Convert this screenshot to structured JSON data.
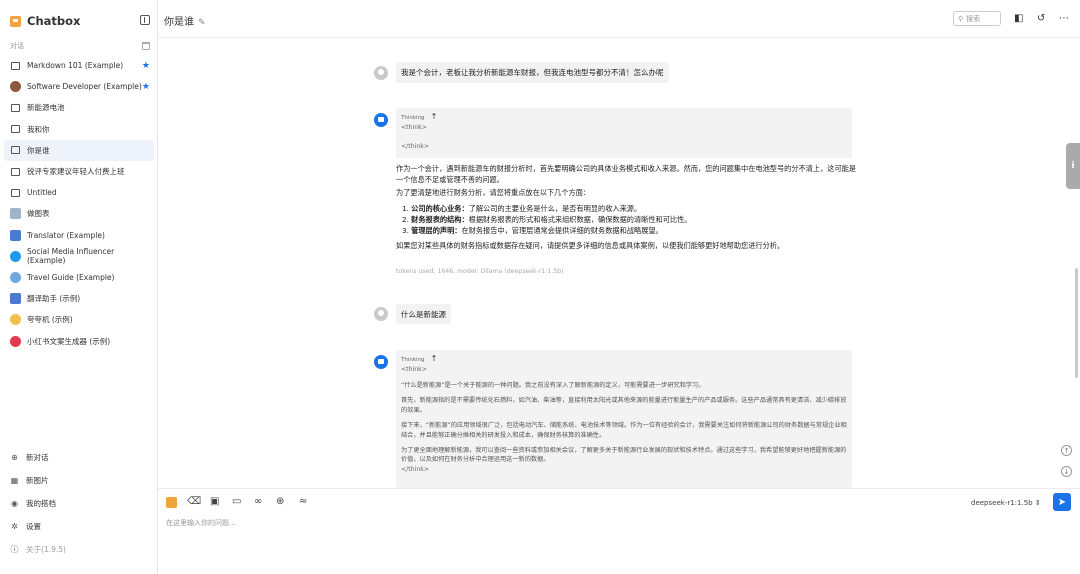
{
  "app": {
    "title": "Chatbox"
  },
  "sidebar": {
    "section_label": "对话",
    "conversations": [
      {
        "label": "Markdown 101 (Example)",
        "starred": true
      },
      {
        "label": "Software Developer (Example)",
        "starred": true
      },
      {
        "label": "新能源电池"
      },
      {
        "label": "我和你"
      },
      {
        "label": "你是谁",
        "active": true
      },
      {
        "label": "锐评专家建议年轻人付费上班"
      },
      {
        "label": "Untitled"
      },
      {
        "label": "做图表"
      },
      {
        "label": "Translator (Example)"
      },
      {
        "label": "Social Media Influencer (Example)"
      },
      {
        "label": "Travel Guide (Example)"
      },
      {
        "label": "翻译助手 (示例)"
      },
      {
        "label": "夸夸机 (示例)"
      },
      {
        "label": "小红书文案生成器 (示例)"
      }
    ],
    "bottom": {
      "new_chat": "新对话",
      "new_image": "新图片",
      "my_partners": "我的搭档",
      "settings": "设置",
      "about": "关于(1.9.5)"
    }
  },
  "header": {
    "title": "你是谁",
    "search_placeholder": "搜索"
  },
  "messages": {
    "q1": "我是个会计，老板让我分析新能源车财报，但我连电池型号都分不清！怎么办呢",
    "a1": {
      "thinking_label": "Thinking",
      "think_open": "<think>",
      "think_close": "</think>",
      "intro": "作为一个会计，遇到新能源车的财报分析时，首先要明确公司的具体业务模式和收入来源。然而，您的问题集中在电池型号的分不清上，这可能是一个信息不足或管理不善的问题。",
      "lead": "为了更清楚地进行财务分析，请您将重点放在以下几个方面：",
      "items": [
        {
          "num": "1.",
          "bold": "公司的核心业务：",
          "text": "了解公司的主要业务是什么，是否有明显的收入来源。"
        },
        {
          "num": "2.",
          "bold": "财务报表的结构：",
          "text": "根据财务报表的形式和格式来组织数据，确保数据的清晰性和可比性。"
        },
        {
          "num": "3.",
          "bold": "管理层的声明：",
          "text": "在财务报告中，管理层通常会提供详细的财务数据和战略展望。"
        }
      ],
      "outro": "如果您对某些具体的财务指标或数据存在疑问，请提供更多详细的信息或具体案例，以便我们能够更好地帮助您进行分析。",
      "meta": "tokens used: 1646, model: Ollama (deepseek-r1:1.5b)"
    },
    "q2": "什么是新能源",
    "a2": {
      "thinking_label": "Thinking",
      "think_open": "<think>",
      "paras": [
        "“什么是新能源”是一个关于能源的一种问题。我之前没有深入了解新能源的定义，可能需要进一步研究和学习。",
        "首先，新能源指的是不需要传统化石燃料，如汽油、柴油等，直接利用太阳光或其他来源的能量进行能量生产的产品或服务。这些产品通常具有更清洁、减少碳排放的效果。",
        "接下来，“新能源”的应用领域很广泛，包括电动汽车、储能系统、电池技术等领域。作为一位有经验的会计，我需要关注如何将新能源公司的财务数据与常规企业相结合，并且能够正确分摊相关的研发投入和成本，确保财务核算的准确性。",
        "为了更全面地理解新能源，我可以查阅一些资料或参加相关会议，了解更多关于新能源行业发展的现状和技术特点。通过这些学习，我希望能够更好地把握新能源的价值，以及如何在财务分析中合理运用这一新的数据。"
      ],
      "think_close": "</think>"
    }
  },
  "input": {
    "placeholder": "在这里输入你的问题...",
    "model": "deepseek-r1:1.5b"
  },
  "side_tab_label": "i"
}
